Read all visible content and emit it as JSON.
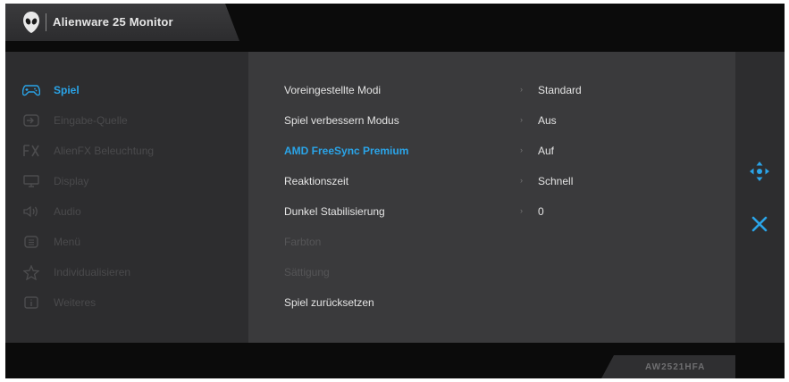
{
  "header": {
    "title": "Alienware 25 Monitor"
  },
  "sidebar": {
    "items": [
      {
        "label": "Spiel",
        "icon": "gamepad-icon",
        "active": true
      },
      {
        "label": "Eingabe-Quelle",
        "icon": "input-source-icon"
      },
      {
        "label": "AlienFX Beleuchtung",
        "icon": "fx-icon"
      },
      {
        "label": "Display",
        "icon": "display-icon"
      },
      {
        "label": "Audio",
        "icon": "speaker-icon"
      },
      {
        "label": "Menü",
        "icon": "menu-icon"
      },
      {
        "label": "Individualisieren",
        "icon": "star-icon"
      },
      {
        "label": "Weiteres",
        "icon": "info-icon"
      }
    ]
  },
  "menu": {
    "rows": [
      {
        "label": "Voreingestellte Modi",
        "value": "Standard"
      },
      {
        "label": "Spiel verbessern Modus",
        "value": "Aus"
      },
      {
        "label": "AMD FreeSync Premium",
        "value": "Auf",
        "highlight": true
      },
      {
        "label": "Reaktionszeit",
        "value": "Schnell"
      },
      {
        "label": "Dunkel Stabilisierung",
        "value": "0"
      },
      {
        "label": "Farbton",
        "disabled": true
      },
      {
        "label": "Sättigung",
        "disabled": true
      },
      {
        "label": "Spiel zurücksetzen"
      }
    ],
    "arrow_glyph": "›"
  },
  "footer": {
    "model": "AW2521HFA"
  },
  "colors": {
    "accent": "#2aa4e8",
    "panel": "#3a3a3c",
    "background": "#2d2d2f"
  }
}
